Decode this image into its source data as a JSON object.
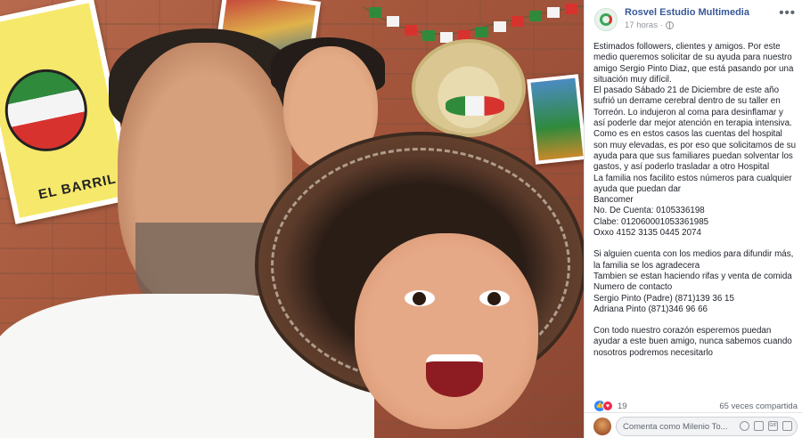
{
  "photo": {
    "card_label": "EL BARRIL"
  },
  "post": {
    "page_name": "Rosvel Estudio Multimedia",
    "time": "17 horas",
    "more_icon": "more-options-icon",
    "paragraph_1": "Estimados followers, clientes y amigos. Por este medio queremos solicitar de su ayuda para nuestro amigo Sergio Pinto Diaz, que está pasando por una situación muy difícil.",
    "paragraph_2": "El pasado Sábado 21 de Diciembre de este año sufrió un derrame cerebral dentro de su taller en Torreón. Lo indujeron al coma para desinflamar y así poderle dar mejor atención en terapia intensiva.",
    "paragraph_3": "Como es en estos casos las cuentas del hospital son muy elevadas, es por eso que solicitamos de su ayuda para que sus familiares puedan solventar los gastos, y así poderlo trasladar a otro Hospital",
    "paragraph_4": "La familia nos facilito estos números para cualquier ayuda que puedan dar",
    "bank": "Bancomer",
    "account": "No. De Cuenta: 0105336198",
    "clabe": "Clabe: 012060001053361985",
    "oxxo": "Oxxo 4152 3135 0445 2074",
    "paragraph_5": "Si alguien cuenta con los medios para difundir más, la familia se los agradecera",
    "paragraph_6": "Tambien se estan haciendo rifas y venta de comida",
    "contact_title": "Numero de contacto",
    "contact_1": "Sergio Pinto (Padre) (871)139 36 15",
    "contact_2": "Adriana Pinto (871)346 96 66",
    "paragraph_7": "Con todo nuestro corazón esperemos puedan ayudar a este buen amigo, nunca sabemos cuando nosotros podremos necesitarlo"
  },
  "reactions": {
    "count": "19",
    "shares": "65 veces compartida"
  },
  "comment": {
    "placeholder": "Comenta como Milenio To..."
  }
}
